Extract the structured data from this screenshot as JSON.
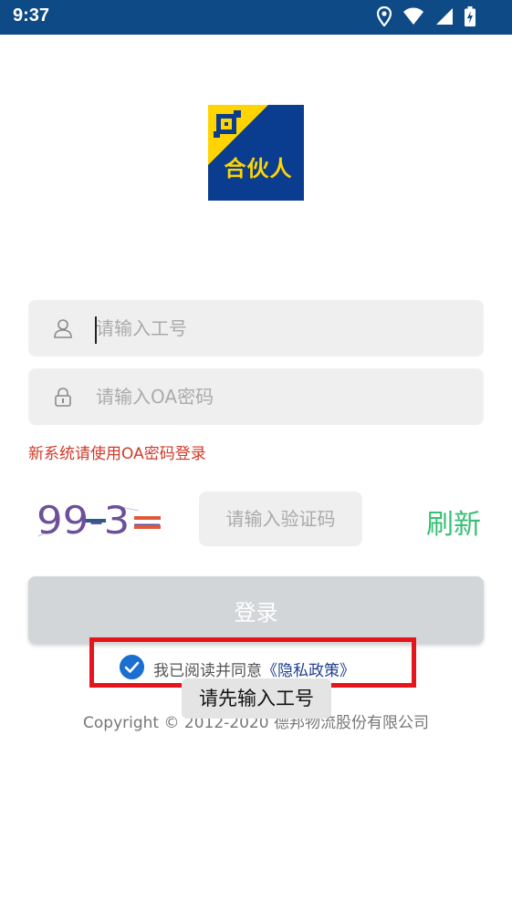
{
  "status_bar": {
    "time": "9:37",
    "icons": [
      "location-icon",
      "wifi-icon",
      "signal-icon",
      "battery-charging-icon"
    ]
  },
  "logo": {
    "text": "合伙人",
    "colors": {
      "blue": "#0a3d8f",
      "yellow": "#ffd400"
    }
  },
  "form": {
    "employee_id": {
      "placeholder": "请输入工号",
      "value": ""
    },
    "password": {
      "placeholder": "请输入OA密码",
      "value": ""
    },
    "hint": "新系统请使用OA密码登录",
    "captcha": {
      "image_text": "99-3=",
      "placeholder": "请输入验证码",
      "value": "",
      "refresh_label": "刷新"
    },
    "login_label": "登录"
  },
  "agreement": {
    "checked": true,
    "text": "我已阅读并同意",
    "policy_link": "《隐私政策》"
  },
  "footer": {
    "copyright": "Copyright © 2012-2020 德邦物流股份有限公司"
  },
  "toast": {
    "message": "请先输入工号"
  },
  "colors": {
    "status_bar": "#0d4a86",
    "accent_green": "#35c074",
    "hint_red": "#d23a2a",
    "highlight_red": "#e8141b",
    "check_blue": "#1b6fd0"
  }
}
